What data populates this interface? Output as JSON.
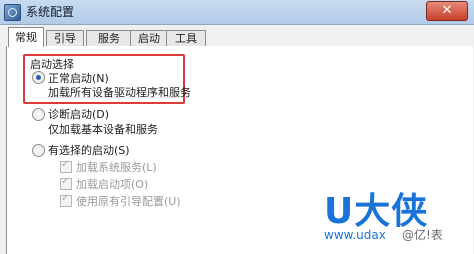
{
  "window": {
    "title": "系统配置",
    "close_glyph": "✕"
  },
  "tabs": [
    {
      "label": "常规",
      "active": true
    },
    {
      "label": "引导",
      "active": false
    },
    {
      "label": "服务",
      "active": false
    },
    {
      "label": "启动",
      "active": false
    },
    {
      "label": "工具",
      "active": false
    }
  ],
  "startup": {
    "group_label": "启动选择",
    "options": [
      {
        "label": "正常启动(N)",
        "desc": "加载所有设备驱动程序和服务",
        "selected": true
      },
      {
        "label": "诊断启动(D)",
        "desc": "仅加载基本设备和服务",
        "selected": false
      },
      {
        "label": "有选择的启动(S)",
        "selected": false
      }
    ],
    "selective_items": [
      {
        "label": "加载系统服务(L)",
        "checked": true,
        "enabled": false
      },
      {
        "label": "加载启动项(O)",
        "checked": true,
        "enabled": false
      },
      {
        "label": "使用原有引导配置(U)",
        "checked": true,
        "enabled": false
      }
    ]
  },
  "watermark": {
    "logo": "U大侠",
    "url": "www.udax",
    "mark": "@亿!表",
    "color": "#1a73d9"
  },
  "colors": {
    "highlight": "#dd3a3a",
    "radio_dot": "#2c5cae"
  }
}
